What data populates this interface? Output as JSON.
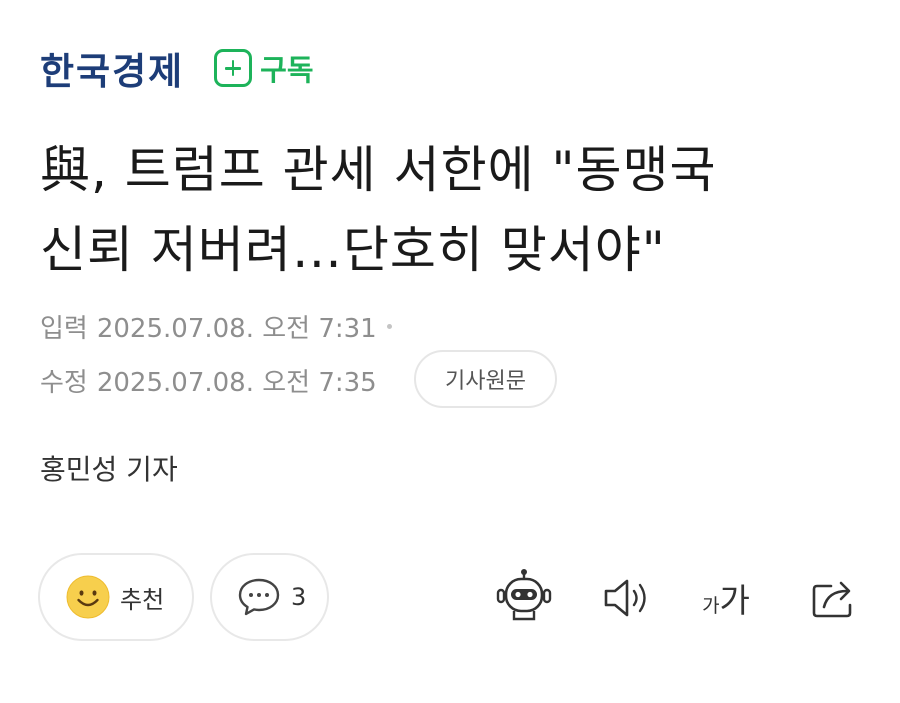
{
  "press": {
    "name": "한국경제",
    "subscribe_label": "구독"
  },
  "article": {
    "headline_line1": "與, 트럼프 관세 서한에 \"동맹국",
    "headline_line2": "신뢰 저버려…단호히 맞서야\"",
    "published_label": "입력",
    "published_time": "2025.07.08. 오전 7:31",
    "modified_label": "수정",
    "modified_time": "2025.07.08. 오전 7:35",
    "origin_button": "기사원문",
    "reporter": "홍민성 기자"
  },
  "actions": {
    "like_label": "추천",
    "comment_count": "3",
    "font_small": "가",
    "font_big": "가"
  },
  "colors": {
    "press_blue": "#1d3d78",
    "subscribe_green": "#1db35a",
    "meta_gray": "#8e8e8e"
  },
  "icons": [
    "plus-icon",
    "smile-icon",
    "speech-bubble-icon",
    "robot-icon",
    "speaker-icon",
    "font-size-icon",
    "share-icon"
  ]
}
